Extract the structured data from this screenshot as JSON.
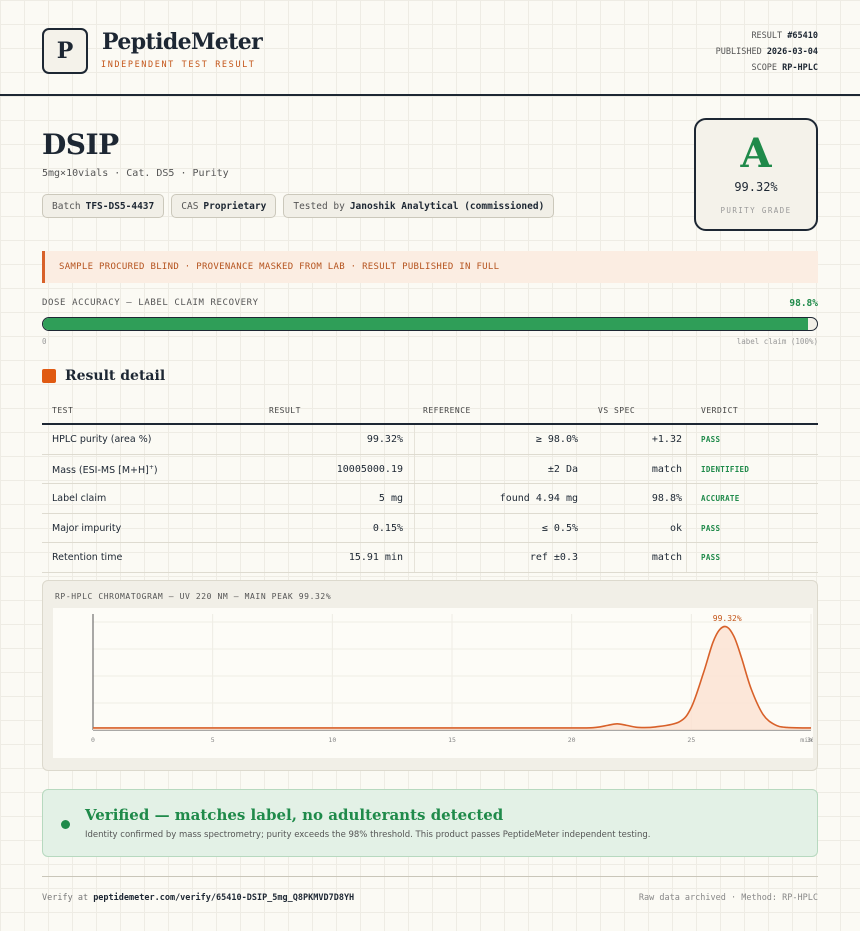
{
  "header": {
    "logo_letter": "P",
    "brand": "PeptideMeter",
    "brand_sub": "INDEPENDENT TEST RESULT",
    "result_label": "RESULT",
    "result_value": "#65410",
    "published_label": "PUBLISHED",
    "published_value": "2026-03-04",
    "scope_label": "SCOPE",
    "scope_value": "RP-HPLC"
  },
  "product": {
    "name": "DSIP",
    "subtitle": "5mg×10vials · Cat. DS5 · Purity",
    "chips": [
      {
        "label": "Batch",
        "value": "TFS-DS5-4437"
      },
      {
        "label": "CAS",
        "value": "Proprietary"
      },
      {
        "label": "Tested by",
        "value": "Janoshik Analytical (commissioned)"
      }
    ]
  },
  "grade": {
    "letter": "A",
    "value": "99.32%",
    "label": "PURITY GRADE",
    "color": "#1f8a4a"
  },
  "notice": "SAMPLE PROCURED BLIND · PROVENANCE MASKED FROM LAB · RESULT PUBLISHED IN FULL",
  "dose": {
    "label": "DOSE ACCURACY — LABEL CLAIM RECOVERY",
    "value_text": "98.8%",
    "fraction": 0.988,
    "min_label": "0",
    "max_label": "label claim (100%)"
  },
  "section_title": "Result detail",
  "table": {
    "headers": [
      "TEST",
      "RESULT",
      "REFERENCE",
      "VS SPEC",
      "VERDICT"
    ],
    "rows": [
      {
        "test": "HPLC purity (area %)",
        "result": "99.32%",
        "reference": "≥ 98.0%",
        "vs": "+1.32",
        "verdict": "PASS"
      },
      {
        "test": "Mass (ESI-MS [M+H]",
        "test_sup": "+",
        "test_end": ")",
        "result": "10005000.19",
        "reference": "±2 Da",
        "vs": "match",
        "verdict": "IDENTIFIED"
      },
      {
        "test": "Label claim",
        "result": "5 mg",
        "reference": "found 4.94 mg",
        "vs": "98.8%",
        "verdict": "ACCURATE"
      },
      {
        "test": "Major impurity",
        "result": "0.15%",
        "reference": "≤ 0.5%",
        "vs": "ok",
        "verdict": "PASS"
      },
      {
        "test": "Retention time",
        "result": "15.91 min",
        "reference": "ref ±0.3",
        "vs": "match",
        "verdict": "PASS"
      }
    ]
  },
  "chart_data": {
    "type": "line",
    "title": "RP-HPLC CHROMATOGRAM — UV 220 NM — MAIN PEAK 99.32%",
    "xlabel": "min",
    "ylabel": "",
    "x_ticks": [
      "0",
      "5",
      "10",
      "15",
      "20",
      "25",
      "30"
    ],
    "xlim": [
      0,
      30
    ],
    "ylim": [
      0,
      1.05
    ],
    "peak_label": "99.32%",
    "line_color": "#d8612a",
    "x": [
      0,
      5,
      10,
      15,
      20,
      21,
      21.5,
      21.9,
      22.3,
      22.8,
      23.5,
      24.5,
      25.0,
      25.5,
      25.9,
      26.2,
      26.5,
      26.8,
      27.1,
      27.5,
      28.0,
      28.5,
      29,
      30
    ],
    "y": [
      0.02,
      0.02,
      0.02,
      0.02,
      0.02,
      0.025,
      0.045,
      0.06,
      0.045,
      0.025,
      0.03,
      0.08,
      0.22,
      0.55,
      0.85,
      0.98,
      1.0,
      0.9,
      0.7,
      0.4,
      0.15,
      0.05,
      0.025,
      0.02
    ]
  },
  "verified": {
    "title": "Verified — matches label, no adulterants detected",
    "text": "Identity confirmed by mass spectrometry; purity exceeds the 98% threshold. This product passes PeptideMeter independent testing."
  },
  "footer": {
    "verify_prefix": "Verify at",
    "verify_url": "peptidemeter.com/verify/65410-DSIP_5mg_Q8PKMVD7D8YH",
    "right": "Raw data archived · Method: RP-HPLC"
  }
}
